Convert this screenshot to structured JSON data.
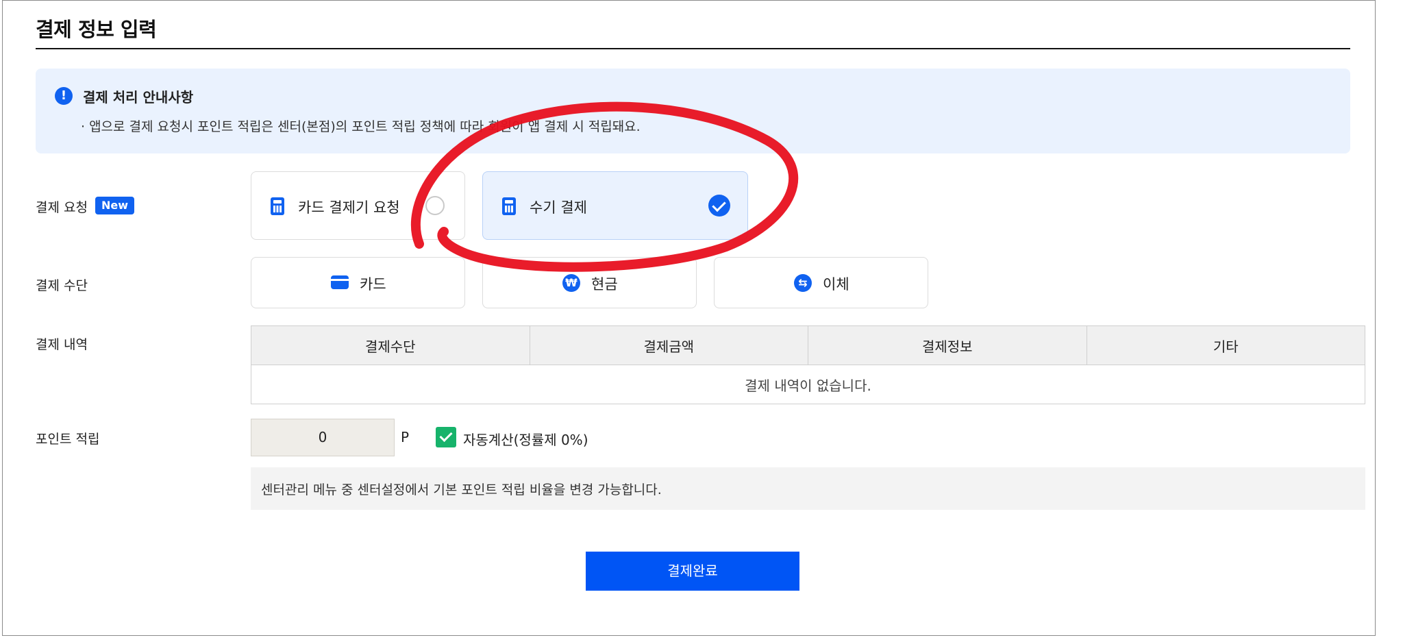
{
  "page": {
    "title": "결제 정보 입력"
  },
  "notice": {
    "title": "결제 처리 안내사항",
    "body": "· 앱으로 결제 요청시 포인트 적립은 센터(본점)의 포인트 적립 정책에 따라 회원이 앱 결제 시 적립돼요."
  },
  "request": {
    "label": "결제 요청",
    "badge": "New",
    "options": [
      {
        "label": "카드 결제기 요청",
        "selected": false
      },
      {
        "label": "수기 결제",
        "selected": true
      }
    ]
  },
  "method": {
    "label": "결제 수단",
    "options": [
      {
        "label": "카드",
        "icon": "card-icon"
      },
      {
        "label": "현금",
        "icon": "cash-icon"
      },
      {
        "label": "이체",
        "icon": "transfer-icon"
      }
    ]
  },
  "history": {
    "label": "결제 내역",
    "columns": [
      "결제수단",
      "결제금액",
      "결제정보",
      "기타"
    ],
    "empty": "결제 내역이 없습니다."
  },
  "points": {
    "label": "포인트 적립",
    "value": "0",
    "unit": "P",
    "auto_label": "자동계산(정률제 0%)",
    "auto_checked": true,
    "help": "센터관리 메뉴 중 센터설정에서 기본 포인트 적립 비율을 변경 가능합니다."
  },
  "submit": {
    "label": "결제완료"
  },
  "colors": {
    "primary": "#1062f0",
    "check": "#17b36b",
    "annotation": "#e8101f",
    "selected_bg": "#eaf2fe"
  }
}
